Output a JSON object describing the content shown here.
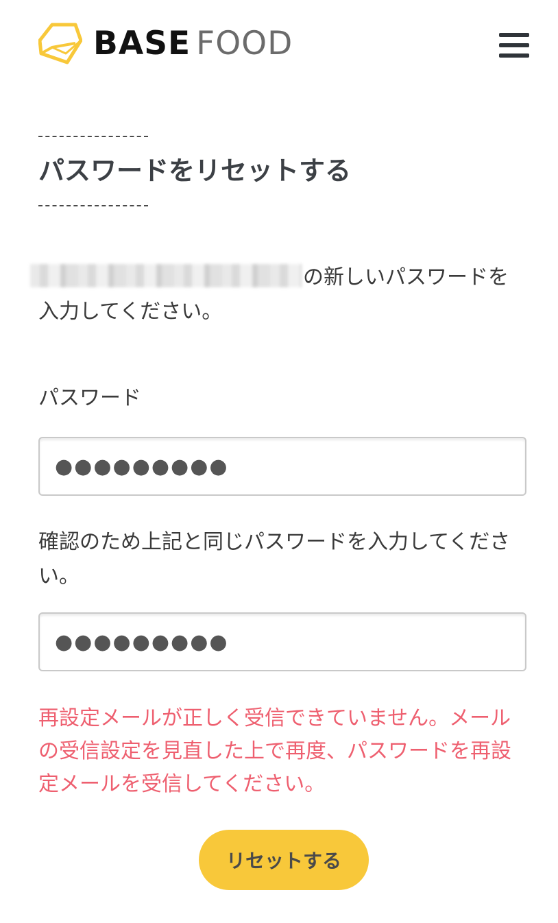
{
  "header": {
    "logo_base": "BASE",
    "logo_food": "FOOD",
    "brand_color": "#f8c83a"
  },
  "page": {
    "title": "パスワードをリセットする",
    "intro_suffix": "の新しいパスワードを入力してください。"
  },
  "form": {
    "password_label": "パスワード",
    "password_value": "●●●●●●●●●",
    "confirm_label": "確認のため上記と同じパスワードを入力してください。",
    "confirm_value": "●●●●●●●●●"
  },
  "error": {
    "message": "再設定メールが正しく受信できていません。メールの受信設定を見直した上で再度、パスワードを再設定メールを受信してください。",
    "color": "#ee5f6f"
  },
  "actions": {
    "reset_label": "リセットする"
  },
  "icons": {
    "logo": "hexagon-logo-icon",
    "menu": "hamburger-menu-icon"
  }
}
